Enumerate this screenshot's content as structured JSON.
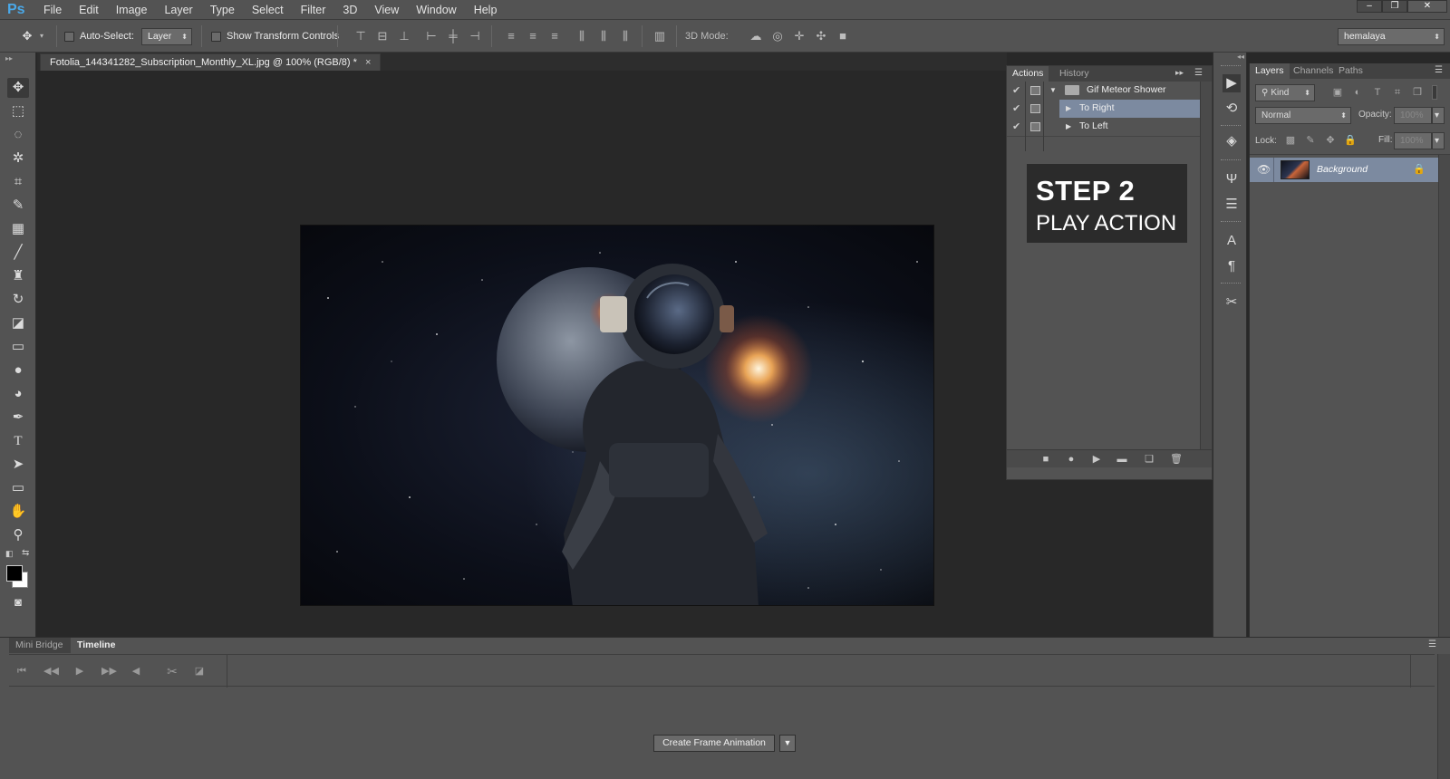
{
  "app": {
    "logo": "Ps"
  },
  "menu": [
    "File",
    "Edit",
    "Image",
    "Layer",
    "Type",
    "Select",
    "Filter",
    "3D",
    "View",
    "Window",
    "Help"
  ],
  "window_controls": {
    "minimize": "–",
    "restore": "❐",
    "close": "✕"
  },
  "options_bar": {
    "auto_select_label": "Auto-Select:",
    "auto_select_value": "Layer",
    "show_transform_label": "Show Transform Controls",
    "mode_3d_label": "3D Mode:",
    "workspace": "hemalaya"
  },
  "document": {
    "tab_title": "Fotolia_144341282_Subscription_Monthly_XL.jpg @ 100% (RGB/8) *",
    "tab_close": "×"
  },
  "actions_panel": {
    "tabs": [
      "Actions",
      "History"
    ],
    "set_name": "Gif Meteor Shower",
    "actions": [
      "To Right",
      "To Left"
    ],
    "selected_action": "To Right"
  },
  "overlay": {
    "title": "STEP 2",
    "subtitle": "PLAY ACTION"
  },
  "layers_panel": {
    "tabs": [
      "Layers",
      "Channels",
      "Paths"
    ],
    "filter_kind": "Kind",
    "blend_mode": "Normal",
    "opacity_label": "Opacity:",
    "opacity_value": "100%",
    "lock_label": "Lock:",
    "fill_label": "Fill:",
    "fill_value": "100%",
    "layer_name": "Background"
  },
  "timeline_panel": {
    "tabs": [
      "Mini Bridge",
      "Timeline"
    ],
    "create_button": "Create Frame Animation"
  },
  "colors": {
    "accent": "#4aa8e8",
    "panel": "#535353",
    "canvas_bg": "#282828",
    "selection": "#7c8aa0"
  }
}
